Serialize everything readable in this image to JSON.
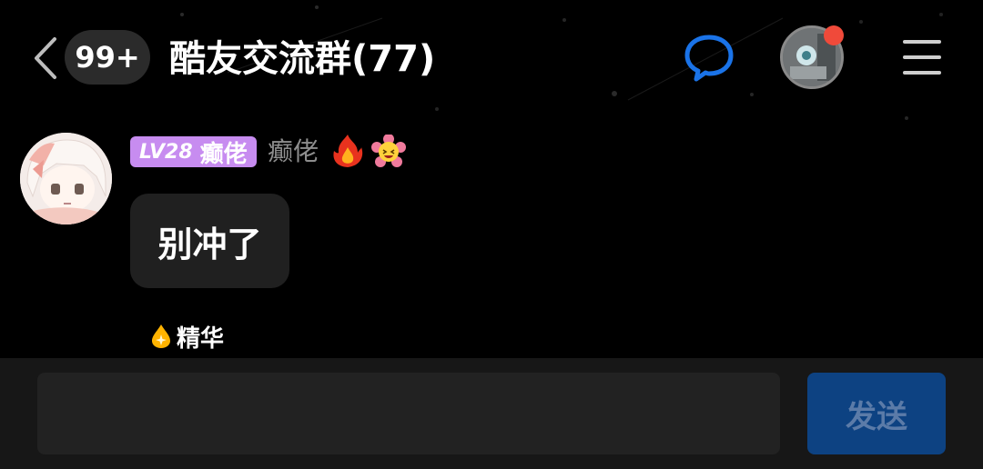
{
  "header": {
    "unread_count": "99+",
    "group_title": "酷友交流群(77)",
    "back_icon": "chevron-left-icon",
    "chat_icon": "chat-bubble-icon",
    "menu_icon": "hamburger-menu-icon"
  },
  "message": {
    "level": "LV28",
    "title_tag": "癫佬",
    "nickname": "癫佬",
    "badges": [
      "fire-icon",
      "flower-icon"
    ],
    "text": "别冲了",
    "essence_label": "精华"
  },
  "input": {
    "placeholder": "",
    "send_label": "发送"
  },
  "colors": {
    "background": "#000000",
    "accent_blue": "#1a73e8",
    "level_tag": "#c78cf0",
    "send_button": "#0d4282",
    "notification_dot": "#f04a3a"
  }
}
